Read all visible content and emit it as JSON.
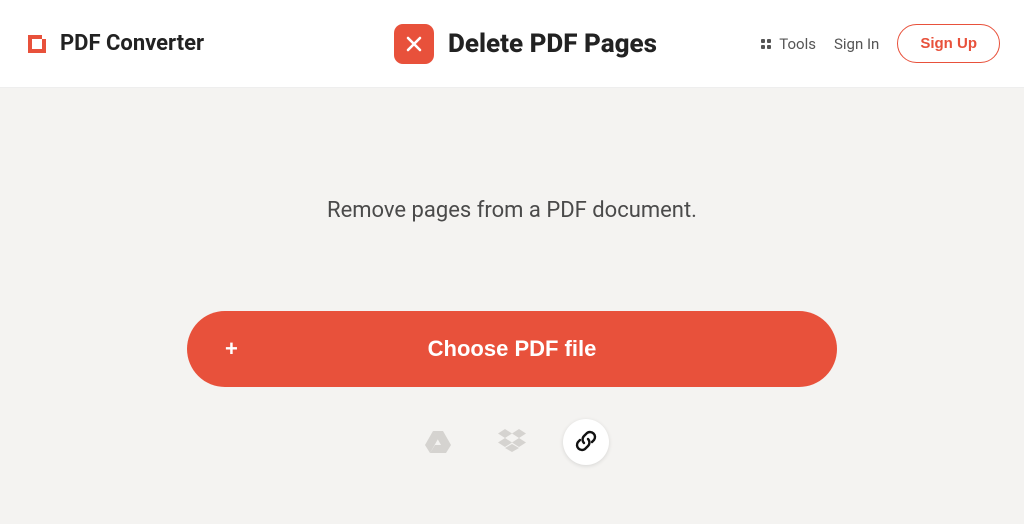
{
  "brand": {
    "name": "PDF Converter"
  },
  "page": {
    "title": "Delete PDF Pages"
  },
  "nav": {
    "tools_label": "Tools",
    "signin_label": "Sign In",
    "signup_label": "Sign Up"
  },
  "main": {
    "subtitle": "Remove pages from a PDF document.",
    "choose_label": "Choose PDF file",
    "plus": "+"
  },
  "icons": {
    "brand": "pdf-converter-logo",
    "title": "close-x-icon",
    "gdrive": "google-drive-icon",
    "dropbox": "dropbox-icon",
    "link": "link-icon"
  },
  "colors": {
    "accent": "#e8513b",
    "muted_icon": "#d5d3d0"
  }
}
